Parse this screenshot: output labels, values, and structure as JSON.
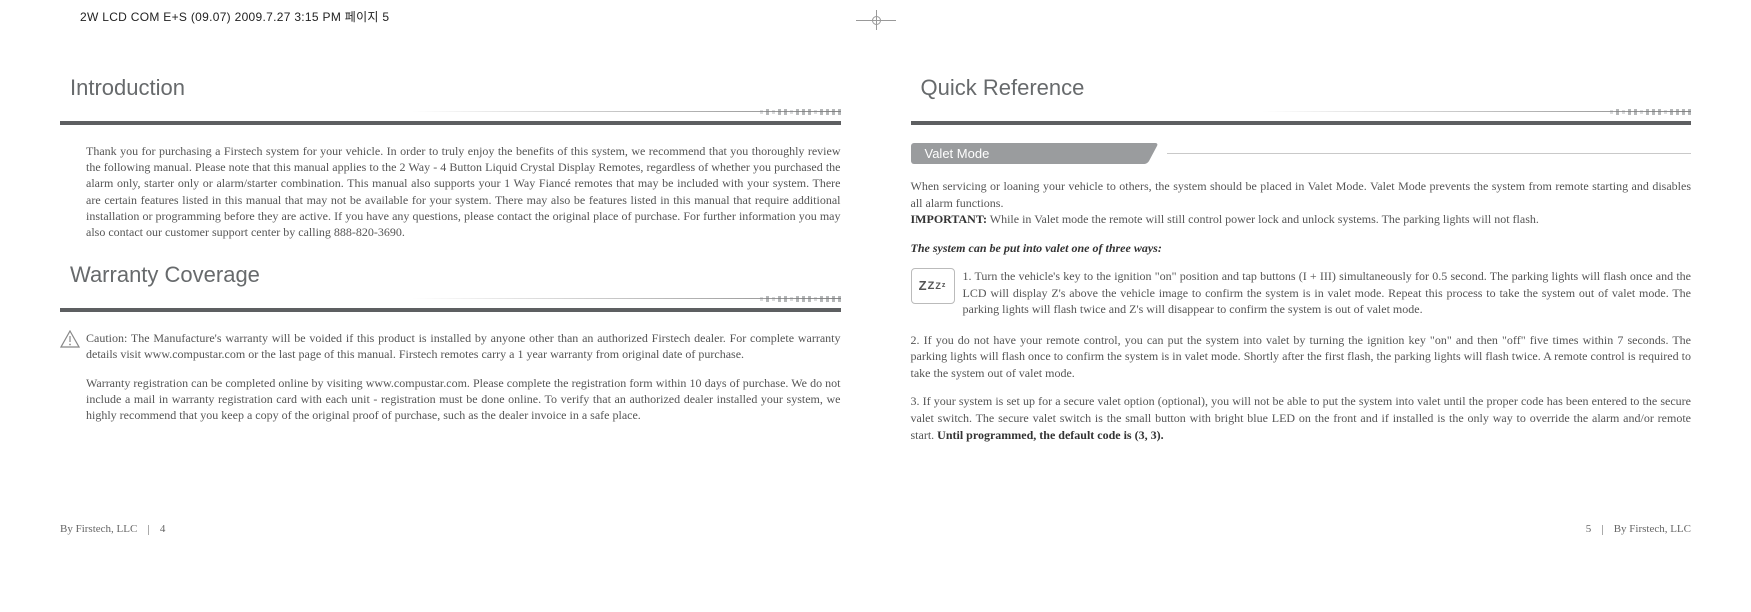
{
  "top_header": "2W LCD COM E+S (09.07)  2009.7.27 3:15 PM  페이지 5",
  "left": {
    "section1_title": "Introduction",
    "intro_para": "Thank you for purchasing a Firstech system for your vehicle. In order to truly enjoy the benefits of this system, we recommend that you thoroughly review the following manual. Please note that this manual applies to the 2 Way - 4 Button Liquid Crystal Display Remotes, regardless of whether you purchased the alarm only, starter only or alarm/starter combination. This manual also supports your 1 Way Fiancé remotes that may be included with your system. There are certain features listed in this manual that may not be available for your system. There may also be features listed in this manual that require additional installation or programming before they are active. If you have any questions, please contact the original place of purchase. For further information you may also contact our customer support center by calling 888-820-3690.",
    "section2_title": "Warranty Coverage",
    "caution_para": "Caution: The Manufacture's warranty will be voided if this product is installed by anyone other than an authorized Firstech dealer. For complete warranty details visit www.compustar.com or the last page of this manual. Firstech remotes carry a 1 year warranty from original date of purchase.",
    "warranty_reg_para": "Warranty registration can be completed online by visiting www.compustar.com. Please complete the registration form within 10 days of purchase. We do not include a mail in warranty registration card with each unit - registration must be done online. To verify that an authorized dealer installed your system, we highly recommend that you keep a copy of the original proof of purchase, such as the dealer invoice in a safe place.",
    "footer_company": "By Firstech, LLC",
    "footer_page": "4"
  },
  "right": {
    "section_title": "Quick Reference",
    "sub_title": "Valet Mode",
    "para1_a": "When servicing or loaning your vehicle to others, the system should be placed in Valet Mode. Valet Mode prevents the system from remote starting and disables all alarm functions.",
    "important_label": "IMPORTANT:",
    "important_text": " While in Valet mode the remote will still control power lock and unlock systems. The parking lights will not flash.",
    "ways_heading": "The system can be put into valet one of three ways:",
    "zzz": "ZZZz",
    "method1": "1.  Turn the vehicle's key to the ignition \"on\" position and tap buttons (I + III) simultaneously for 0.5 second. The parking lights will flash once and the LCD will display Z's above the vehicle image to confirm the system is in valet mode. Repeat this process to take the system out of valet mode. The parking lights will flash twice and Z's will disappear to confirm the system is out of valet mode.",
    "method2": "2. If you do not have your remote control, you can put the system into valet by turning the ignition key \"on\" and then \"off\" five times within 7 seconds. The parking lights will flash once to confirm the system is in valet mode. Shortly after the first flash, the parking lights will flash twice. A remote control is required to take the system out of valet mode.",
    "method3_a": "3.  If your system is set up for a secure valet option (optional), you will not be able to put the system into valet until the proper code has been entered to the secure valet switch. The secure valet switch is the small button with bright blue LED on the front and if installed is the only way to override the alarm and/or remote start. ",
    "method3_bold": "Until programmed, the default code is (3, 3).",
    "footer_page": "5",
    "footer_company": "By Firstech, LLC"
  }
}
